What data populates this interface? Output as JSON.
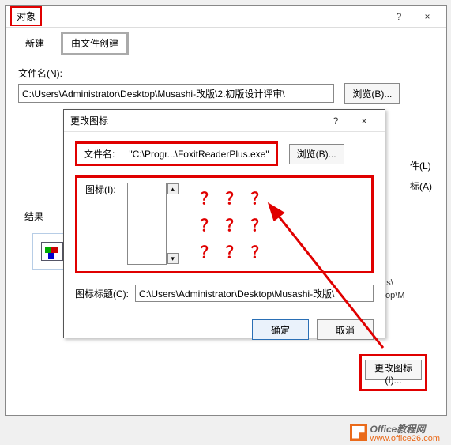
{
  "outer": {
    "title": "对象",
    "help_icon": "?",
    "close_icon": "×",
    "tabs": {
      "new": "新建",
      "from_file": "由文件创建"
    },
    "filename_label": "文件名(N):",
    "filename_value": "C:\\Users\\Administrator\\Desktop\\Musashi-改版\\2.初版设计评审\\",
    "browse_label": "浏览(B)...",
    "link_label": "件(L)",
    "showicon_label": "标(A)",
    "result_label": "结果",
    "peek_line1": "sers\\",
    "peek_line2": "sktop\\M",
    "change_icon_label": "更改图标(I)..."
  },
  "inner": {
    "title": "更改图标",
    "help_icon": "?",
    "close_icon": "×",
    "file_label": "文件名:",
    "file_path": "\"C:\\Progr...\\FoxitReaderPlus.exe\"",
    "browse_label": "浏览(B)...",
    "icon_label": "图标(I):",
    "qmark": "？",
    "caption_label": "图标标题(C):",
    "caption_value": "C:\\Users\\Administrator\\Desktop\\Musashi-改版\\",
    "ok": "确定",
    "cancel": "取消"
  },
  "watermark": {
    "brand_a": "Office",
    "brand_b": "教程网",
    "url": "www.office26.com"
  }
}
